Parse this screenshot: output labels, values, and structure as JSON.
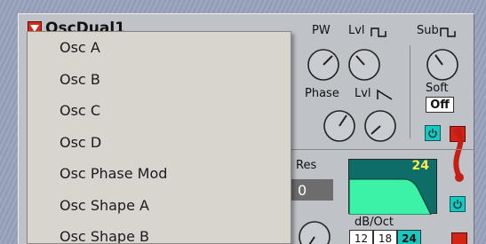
{
  "module": {
    "title": "OscDual1",
    "labels": {
      "pw": "PW",
      "lvl_square": "Lvl",
      "sub": "Sub",
      "phase": "Phase",
      "lvl_saw": "Lvl",
      "soft": "Soft",
      "res": "Res",
      "db_oct": "dB/Oct"
    },
    "soft_value": "Off",
    "res_value": "0",
    "filter_slope_display": "24",
    "db_options": [
      "12",
      "18",
      "24"
    ],
    "db_selected": "24",
    "colors": {
      "panel": "#bfc2c7",
      "accent_cyan": "#18c7c0",
      "accent_red": "#d42418",
      "display_bg": "#0f6d67",
      "display_text": "#ffe94a",
      "filter_curve": "#3cf2a6"
    }
  },
  "dropdown": {
    "items": [
      "Osc A",
      "Osc B",
      "Osc C",
      "Osc D",
      "Osc Phase Mod",
      "Osc Shape A",
      "Osc Shape B"
    ]
  },
  "icons": {
    "menu": "triangle-down-icon",
    "square_wave": "square-wave-icon",
    "saw_wave": "saw-wave-icon",
    "power": "power-icon"
  }
}
